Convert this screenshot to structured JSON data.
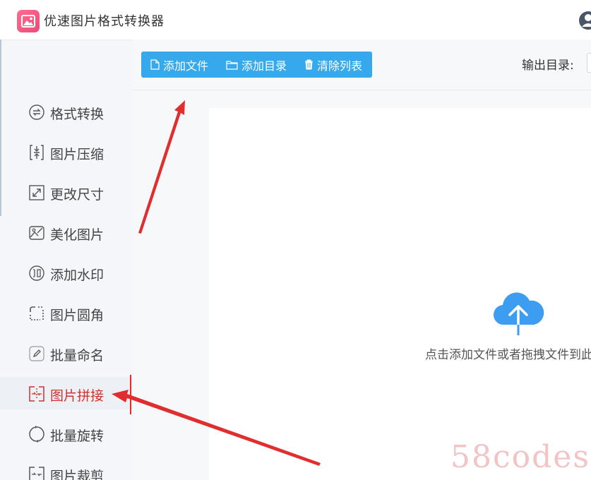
{
  "app": {
    "title": "优速图片格式转换器"
  },
  "sidebar": {
    "items": [
      {
        "label": "格式转换",
        "icon": "format-convert-icon"
      },
      {
        "label": "图片压缩",
        "icon": "compress-icon"
      },
      {
        "label": "更改尺寸",
        "icon": "resize-icon"
      },
      {
        "label": "美化图片",
        "icon": "beautify-icon"
      },
      {
        "label": "添加水印",
        "icon": "watermark-icon"
      },
      {
        "label": "图片圆角",
        "icon": "rounded-corner-icon"
      },
      {
        "label": "批量命名",
        "icon": "rename-icon"
      },
      {
        "label": "图片拼接",
        "icon": "stitch-icon"
      },
      {
        "label": "批量旋转",
        "icon": "rotate-icon"
      },
      {
        "label": "图片裁剪",
        "icon": "crop-icon"
      }
    ],
    "active_index": 7
  },
  "toolbar": {
    "add_file": "添加文件",
    "add_folder": "添加目录",
    "clear_list": "清除列表",
    "output_label": "输出目录:"
  },
  "main": {
    "drop_hint": "点击添加文件或者拖拽文件到此"
  },
  "watermark": {
    "text": "58codes"
  },
  "colors": {
    "accent": "#35a9eb",
    "active_text": "#d0312d",
    "arrow": "#e02d2d",
    "upload": "#3d9df0"
  }
}
